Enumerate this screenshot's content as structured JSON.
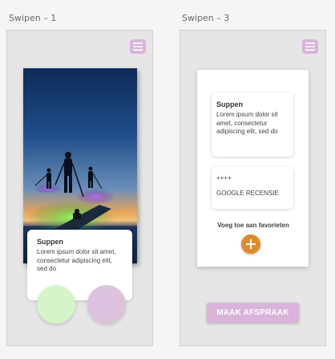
{
  "colors": {
    "artboard_bg": "#e6e6e6",
    "menu_accent": "#d9b3d9",
    "circle_green": "#d4f5c8",
    "circle_purple": "#dcc3dd",
    "plus_orange": "#e08a2a",
    "appointment_button": "#d9b3d9"
  },
  "frames": [
    {
      "label": "Swipen – 1",
      "menu_icon": "hamburger-icon",
      "card": {
        "title": "Suppen",
        "body": "Lorem ipsum dolor sit amet, consectetur adipiscing elit, sed do"
      },
      "photo_icon": "paddleboard-sunset-photo"
    },
    {
      "label": "Swipen – 3",
      "menu_icon": "hamburger-icon",
      "card": {
        "title": "Suppen",
        "body": "Lorem ipsum dolor sit amet, consectetur adipiscing elit, sed do"
      },
      "review": {
        "rating": "++++",
        "label": "GOOGLE RECENSIE"
      },
      "favorites_label": "Voeg toe aan favorieten",
      "plus_icon": "plus-icon",
      "appointment_button": "MAAK AFSPRAAK"
    }
  ]
}
